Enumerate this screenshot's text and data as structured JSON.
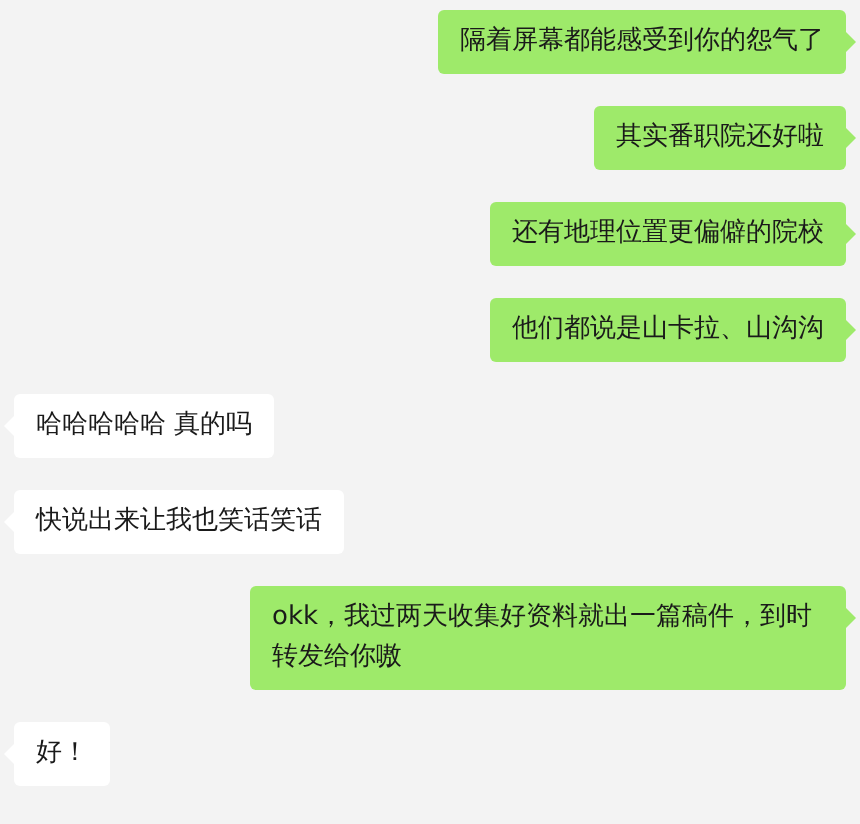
{
  "messages": [
    {
      "kind": "sent",
      "text": "隔着屏幕都能感受到你的怨气了"
    },
    {
      "kind": "sent",
      "text": "其实番职院还好啦"
    },
    {
      "kind": "sent",
      "text": "还有地理位置更偏僻的院校"
    },
    {
      "kind": "sent",
      "text": "他们都说是山卡拉、山沟沟"
    },
    {
      "kind": "received",
      "text": "哈哈哈哈哈 真的吗"
    },
    {
      "kind": "received",
      "text": "快说出来让我也笑话笑话"
    },
    {
      "kind": "sent",
      "text": "okk，我过两天收集好资料就出一篇稿件，到时转发给你嗷"
    },
    {
      "kind": "received",
      "text": "好！"
    }
  ]
}
